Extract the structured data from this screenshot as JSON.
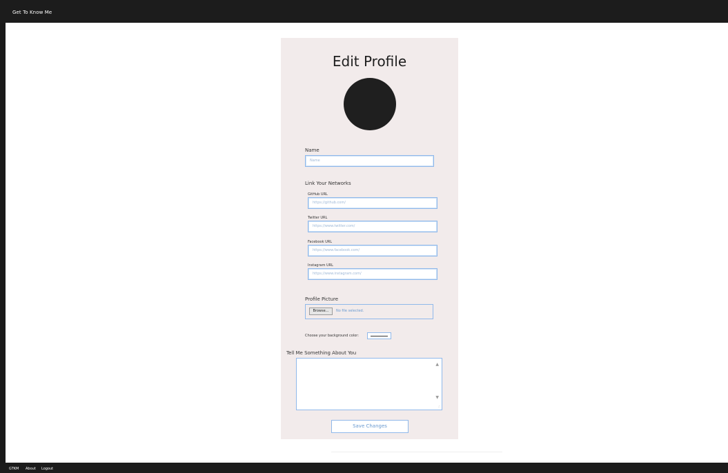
{
  "header": {
    "brand": "Get To Know Me"
  },
  "profile": {
    "title": "Edit Profile",
    "name_label": "Name",
    "name_placeholder": "Name",
    "networks_heading": "Link Your Networks",
    "networks": [
      {
        "label": "GitHub URL",
        "placeholder": "https://github.com/"
      },
      {
        "label": "Twitter URL",
        "placeholder": "https://www.twitter.com/"
      },
      {
        "label": "Facebook URL",
        "placeholder": "https://www.facebook.com/"
      },
      {
        "label": "Instagram URL",
        "placeholder": "https://www.instagram.com/"
      }
    ],
    "picture_label": "Profile Picture",
    "browse_label": "Browse...",
    "no_file_text": "No file selected.",
    "bg_color_label": "Choose your background color:",
    "about_label": "Tell Me Something About You",
    "save_label": "Save Changes"
  },
  "footer": {
    "links": [
      "GTKM",
      "About",
      "Logout"
    ]
  },
  "colors": {
    "bar": "#1c1c1c",
    "card": "#f2ebeb",
    "accent": "#8fb8ea",
    "avatar": "#1f1f1f"
  }
}
